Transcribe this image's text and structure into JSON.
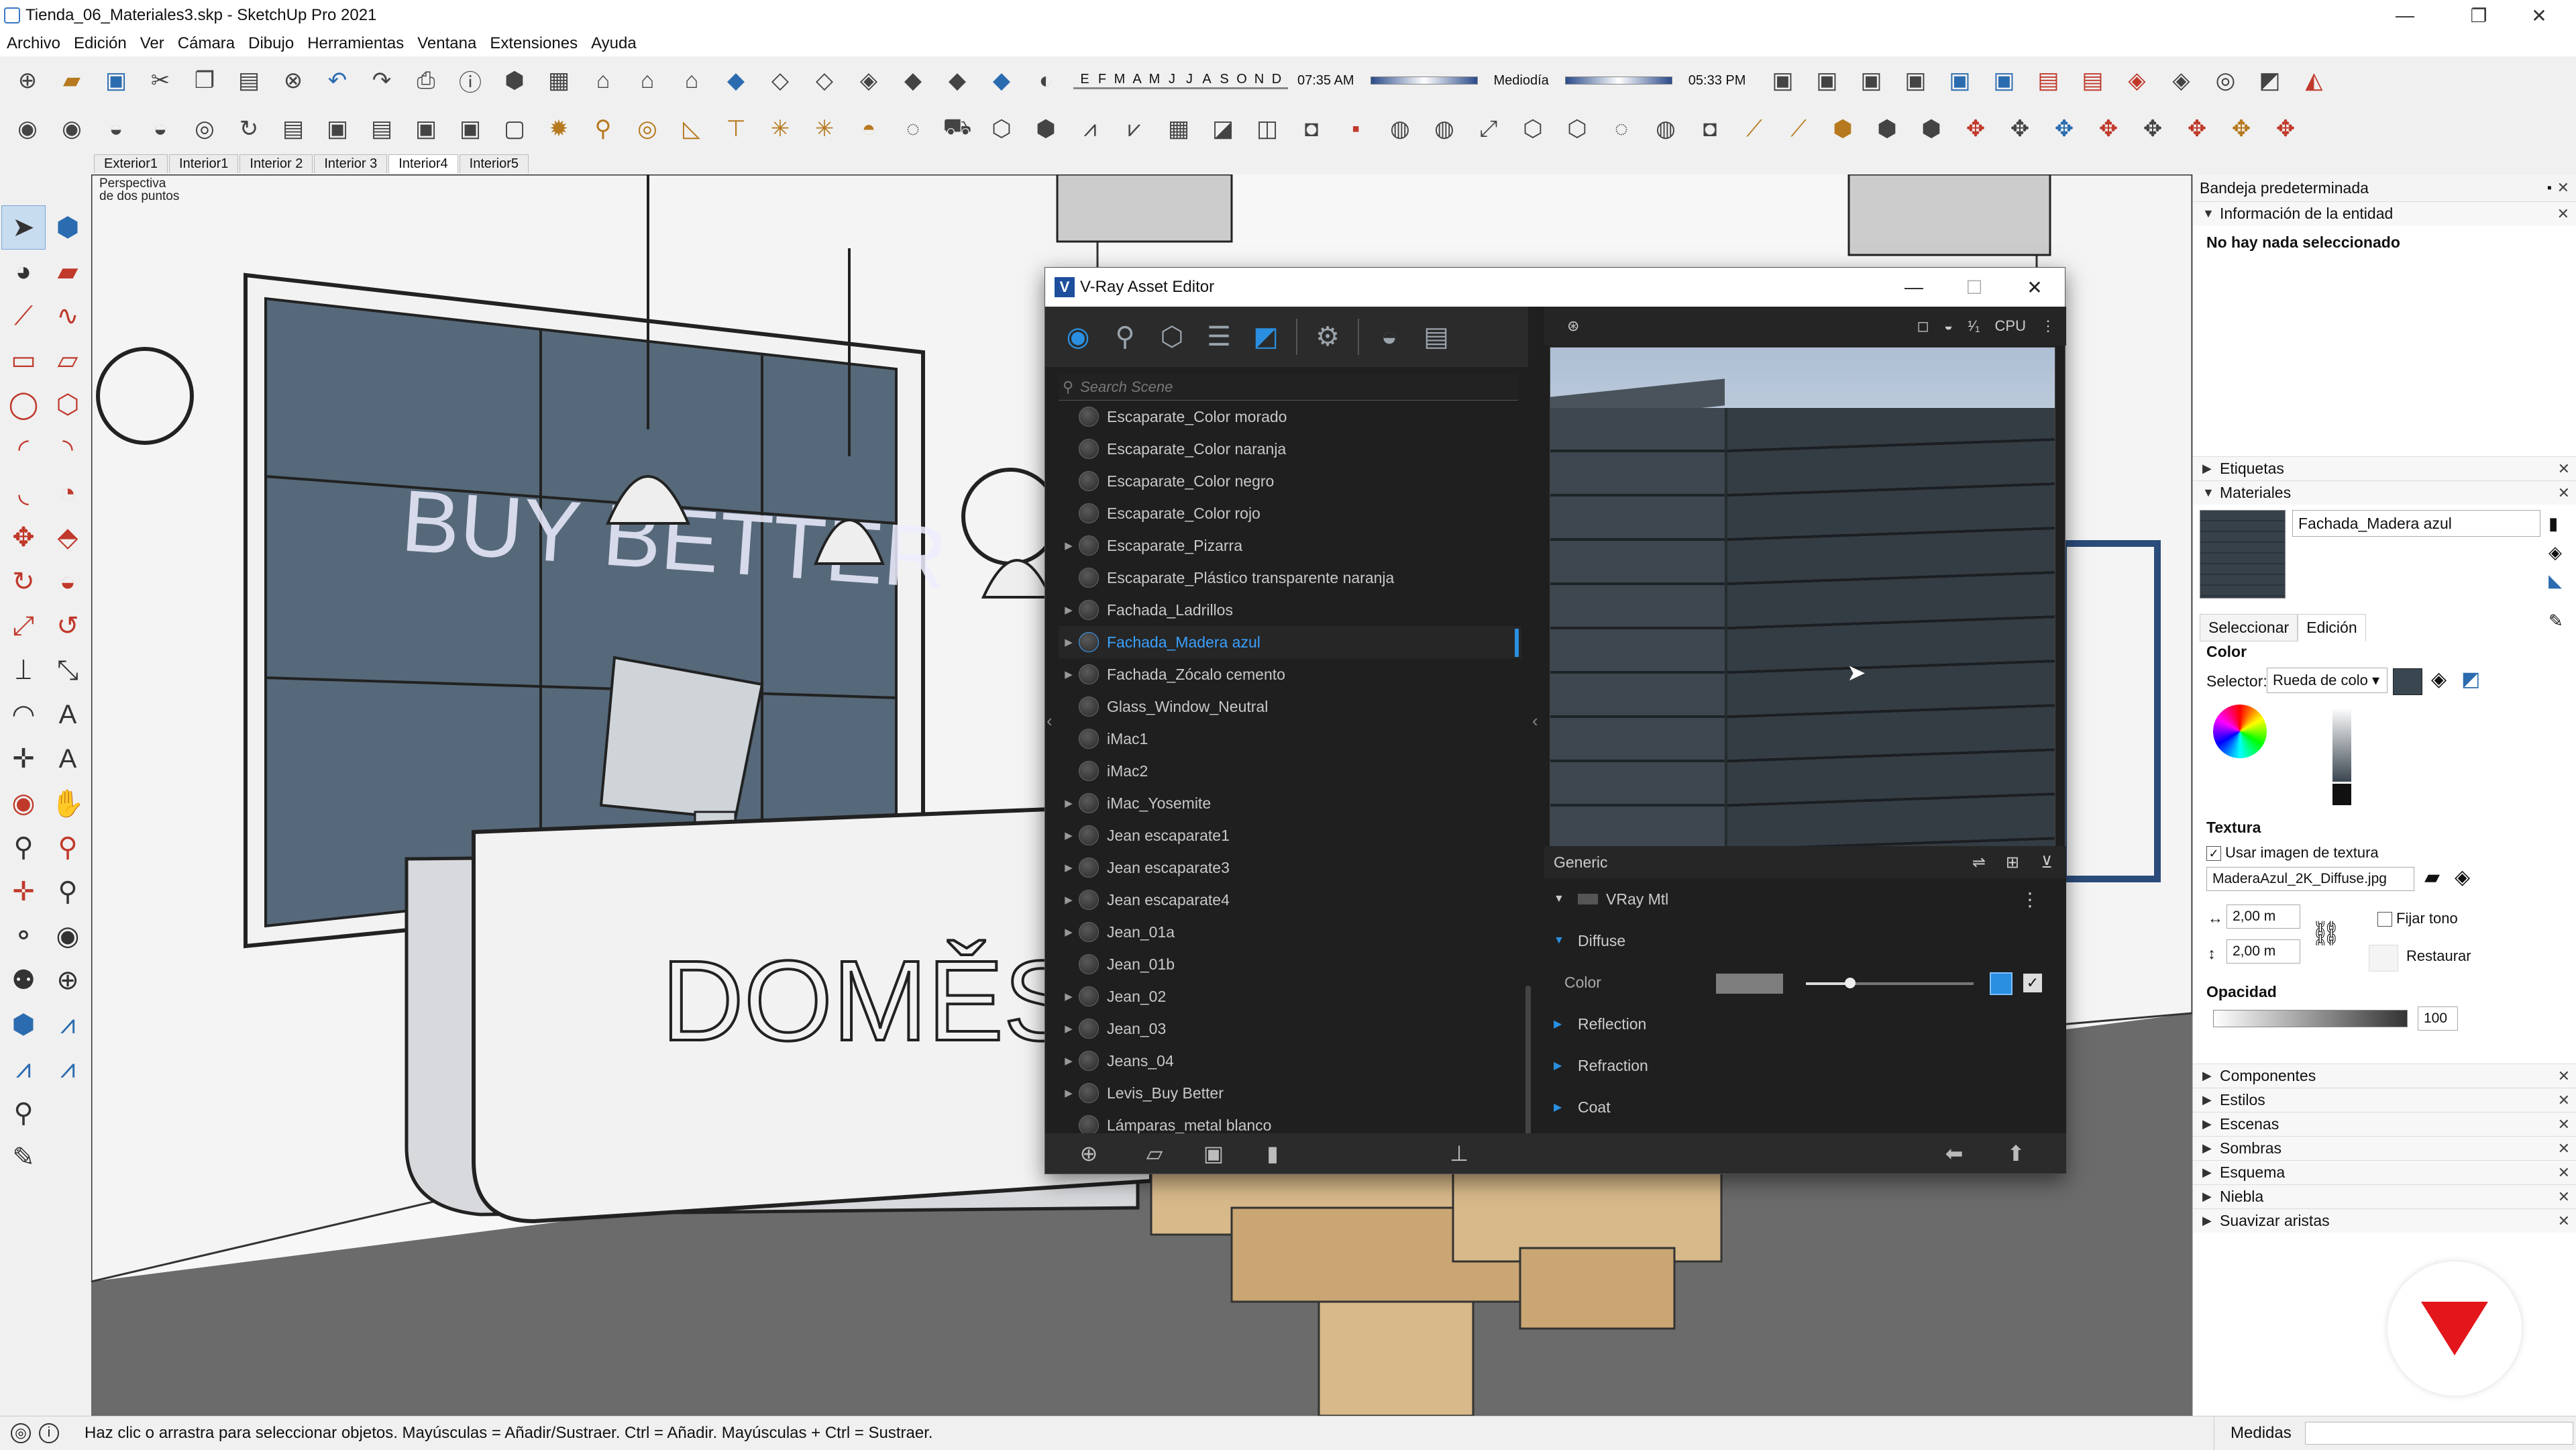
{
  "app": {
    "title": "Tienda_06_Materiales3.skp - SketchUp Pro 2021",
    "menu": [
      "Archivo",
      "Edición",
      "Ver",
      "Cámara",
      "Dibujo",
      "Herramientas",
      "Ventana",
      "Extensiones",
      "Ayuda"
    ]
  },
  "shadow": {
    "months": [
      "E",
      "F",
      "M",
      "A",
      "M",
      "J",
      "J",
      "A",
      "S",
      "O",
      "N",
      "D"
    ],
    "time_start": "07:35 AM",
    "time_mid": "Mediodía",
    "time_end": "05:33 PM"
  },
  "scenes": [
    "Exterior1",
    "Interior1",
    "Interior 2",
    "Interior 3",
    "Interior4",
    "Interior5"
  ],
  "active_scene": "Interior4",
  "viewport": {
    "camera_label_1": "Perspectiva",
    "camera_label_2": "de dos puntos",
    "counter_text": "DOMĚSTI",
    "wall_text": "BUY BETTER"
  },
  "status": {
    "hint": "Haz clic o arrastra para seleccionar objetos. Mayúsculas = Añadir/Sustraer. Ctrl = Añadir. Mayúsculas + Ctrl = Sustraer.",
    "measures_label": "Medidas"
  },
  "tray": {
    "title": "Bandeja predeterminada",
    "entity_info_title": "Información de la entidad",
    "entity_info_text": "No hay nada seleccionado",
    "tags": "Etiquetas",
    "materials": "Materiales",
    "material_name": "Fachada_Madera azul",
    "tab_select": "Seleccionar",
    "tab_edit": "Edición",
    "color_label": "Color",
    "selector_label": "Selector:",
    "selector_value": "Rueda de colo",
    "texture_label": "Textura",
    "use_texture": "Usar imagen de textura",
    "texture_file": "MaderaAzul_2K_Diffuse.jpg",
    "width": "2,00 m",
    "height": "2,00 m",
    "fix_tone": "Fijar tono",
    "restore": "Restaurar",
    "opacity_label": "Opacidad",
    "opacity_value": "100",
    "sections": [
      "Componentes",
      "Estilos",
      "Escenas",
      "Sombras",
      "Esquema",
      "Niebla",
      "Suavizar aristas"
    ]
  },
  "vray": {
    "title": "V-Ray Asset Editor",
    "search_placeholder": "Search Scene",
    "render_mode": "CPU",
    "materials": [
      {
        "name": "Escaparate_Color morado",
        "expandable": false
      },
      {
        "name": "Escaparate_Color naranja",
        "expandable": false
      },
      {
        "name": "Escaparate_Color negro",
        "expandable": false
      },
      {
        "name": "Escaparate_Color rojo",
        "expandable": false
      },
      {
        "name": "Escaparate_Pizarra",
        "expandable": true
      },
      {
        "name": "Escaparate_Plástico transparente naranja",
        "expandable": false
      },
      {
        "name": "Fachada_Ladrillos",
        "expandable": true
      },
      {
        "name": "Fachada_Madera azul",
        "expandable": true,
        "selected": true
      },
      {
        "name": "Fachada_Zócalo cemento",
        "expandable": true
      },
      {
        "name": "Glass_Window_Neutral",
        "expandable": false
      },
      {
        "name": "iMac1",
        "expandable": false
      },
      {
        "name": "iMac2",
        "expandable": false
      },
      {
        "name": "iMac_Yosemite",
        "expandable": true
      },
      {
        "name": "Jean escaparate1",
        "expandable": true
      },
      {
        "name": "Jean escaparate3",
        "expandable": true
      },
      {
        "name": "Jean escaparate4",
        "expandable": true
      },
      {
        "name": "Jean_01a",
        "expandable": true
      },
      {
        "name": "Jean_01b",
        "expandable": false
      },
      {
        "name": "Jean_02",
        "expandable": true
      },
      {
        "name": "Jean_03",
        "expandable": true
      },
      {
        "name": "Jeans_04",
        "expandable": true
      },
      {
        "name": "Levis_Buy Better",
        "expandable": true
      },
      {
        "name": "Lámparas_metal blanco",
        "expandable": false
      }
    ],
    "props": {
      "header": "Generic",
      "material_type": "VRay Mtl",
      "diffuse": "Diffuse",
      "color": "Color",
      "reflection": "Reflection",
      "refraction": "Refraction",
      "coat": "Coat"
    }
  },
  "colors": {
    "vray_accent": "#2a8fe0",
    "vray_bg": "#1f1f1f",
    "brand_red": "#e3161b"
  }
}
